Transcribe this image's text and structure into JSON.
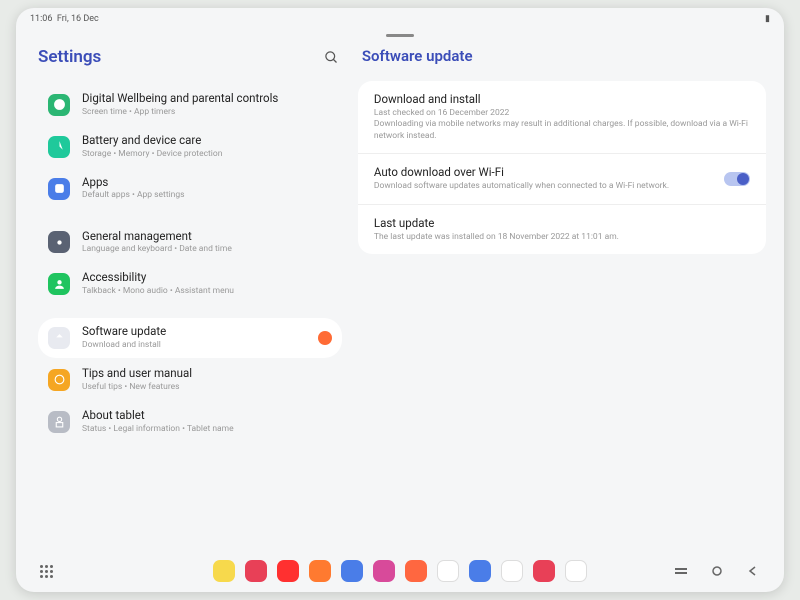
{
  "statusbar": {
    "time": "11:06",
    "date": "Fri, 16 Dec"
  },
  "sidebar": {
    "title": "Settings",
    "items": [
      {
        "title": "Digital Wellbeing and parental controls",
        "sub": "Screen time • App timers",
        "color": "#2bb673"
      },
      {
        "title": "Battery and device care",
        "sub": "Storage • Memory • Device protection",
        "color": "#1fc99b"
      },
      {
        "title": "Apps",
        "sub": "Default apps • App settings",
        "color": "#4a7de8"
      },
      {
        "title": "General management",
        "sub": "Language and keyboard • Date and time",
        "color": "#5a6273"
      },
      {
        "title": "Accessibility",
        "sub": "Talkback • Mono audio • Assistant menu",
        "color": "#1fc45f"
      },
      {
        "title": "Software update",
        "sub": "Download and install",
        "color": "#e8eaf0"
      },
      {
        "title": "Tips and user manual",
        "sub": "Useful tips • New features",
        "color": "#f5a623"
      },
      {
        "title": "About tablet",
        "sub": "Status • Legal information • Tablet name",
        "color": "#b8bcc5"
      }
    ]
  },
  "content": {
    "title": "Software update",
    "rows": [
      {
        "title": "Download and install",
        "line1": "Last checked on 16 December 2022",
        "line2": "Downloading via mobile networks may result in additional charges. If possible, download via a Wi-Fi network instead."
      },
      {
        "title": "Auto download over Wi-Fi",
        "line1": "Download software updates automatically when connected to a Wi-Fi network."
      },
      {
        "title": "Last update",
        "line1": "The last update was installed on 18 November 2022 at 11:01 am."
      }
    ]
  },
  "dock": [
    {
      "bg": "#f7d94c"
    },
    {
      "bg": "#e84057"
    },
    {
      "bg": "#ff3030"
    },
    {
      "bg": "#ff7a30"
    },
    {
      "bg": "#4a7de8"
    },
    {
      "bg": "#d84a9a"
    },
    {
      "bg": "#ff6740"
    },
    {
      "bg": "#ffffff"
    },
    {
      "bg": "#4a7de8"
    },
    {
      "bg": "#ffffff"
    },
    {
      "bg": "#e84057"
    },
    {
      "bg": "#ffffff"
    }
  ]
}
